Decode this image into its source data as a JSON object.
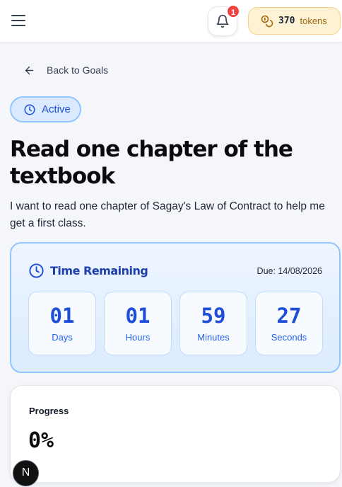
{
  "header": {
    "menu_icon": "hamburger-menu-icon",
    "notifications": {
      "icon": "bell-icon",
      "count": "1"
    },
    "tokens": {
      "icon": "coins-icon",
      "count": "370",
      "label": "tokens",
      "accent": "#f1d48a"
    }
  },
  "back_link": {
    "icon": "arrow-left-icon",
    "label": "Back to Goals"
  },
  "status": {
    "icon": "clock-icon",
    "label": "Active",
    "color": "#1d4ed8"
  },
  "goal": {
    "title": "Read one chapter of the textbook",
    "description": "I want to read one chapter of Sagay's Law of Contract to help me get a first class."
  },
  "countdown": {
    "icon": "clock-icon",
    "title": "Time Remaining",
    "due": "Due: 14/08/2026",
    "units": [
      {
        "value": "01",
        "label": "Days"
      },
      {
        "value": "01",
        "label": "Hours"
      },
      {
        "value": "59",
        "label": "Minutes"
      },
      {
        "value": "27",
        "label": "Seconds"
      }
    ],
    "accent": "#93c5fd"
  },
  "progress": {
    "label": "Progress",
    "value": "0%"
  },
  "floating_badge": {
    "label": "N"
  }
}
